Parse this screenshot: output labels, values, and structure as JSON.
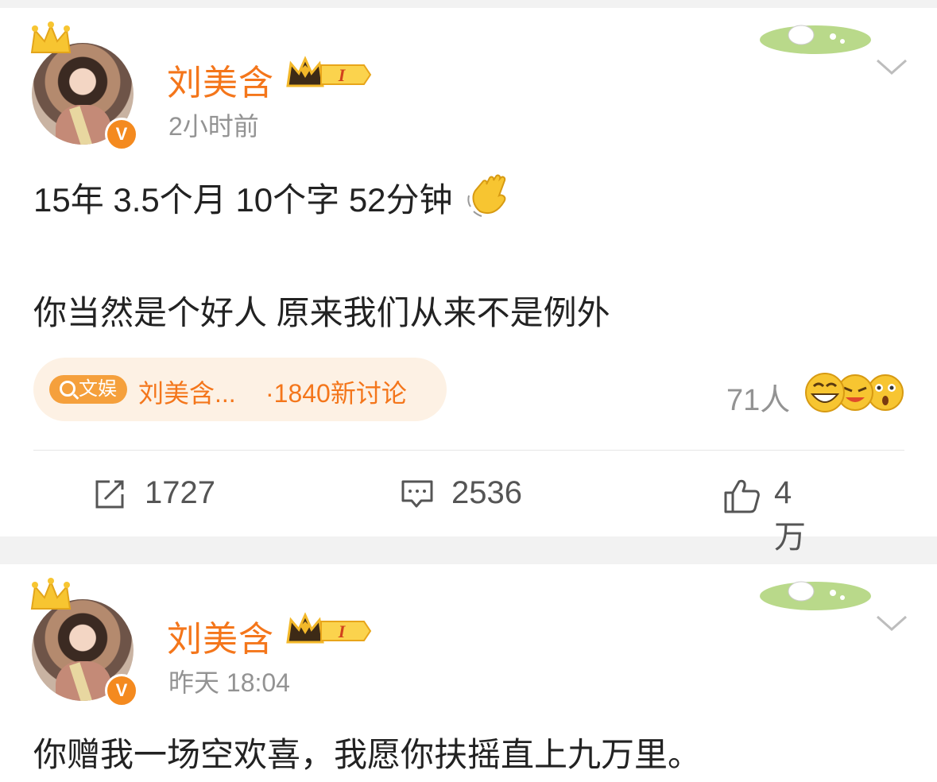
{
  "posts": [
    {
      "author": "刘美含",
      "level": "I",
      "time": "2小时前",
      "lines": [
        "15年 3.5个月 10个字 52分钟",
        "你当然是个好人   原来我们从来不是例外"
      ],
      "topic": {
        "tag": "文娱",
        "title": "刘美含...",
        "count": "·1840新讨论"
      },
      "reactions_count": "71人",
      "actions": {
        "repost": "1727",
        "comment": "2536",
        "like": "4万"
      }
    },
    {
      "author": "刘美含",
      "level": "I",
      "time": "昨天 18:04",
      "lines": [
        "你赠我一场空欢喜，我愿你扶摇直上九万里。"
      ]
    }
  ],
  "colors": {
    "accent": "#f4761b",
    "muted": "#939393",
    "badge": "#f48a1f"
  },
  "icons": [
    "crown-icon",
    "verified-badge",
    "level-crown-badge",
    "decoration-icon",
    "chevron-down-icon",
    "wave-hand-icon",
    "search-icon",
    "emoji-icon",
    "repost-icon",
    "comment-icon",
    "like-icon"
  ]
}
